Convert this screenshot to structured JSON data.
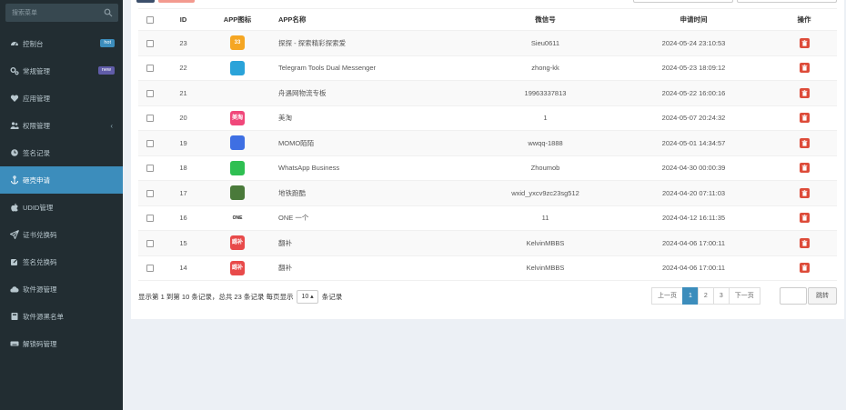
{
  "sidebar": {
    "search_placeholder": "搜索菜单",
    "items": [
      {
        "label": "控制台",
        "icon": "dashboard-icon",
        "badge": "hot",
        "badge_color": "#3c8dbc"
      },
      {
        "label": "常规管理",
        "icon": "cogs-icon",
        "badge": "new",
        "badge_color": "#605ca8"
      },
      {
        "label": "应用管理",
        "icon": "heart-icon"
      },
      {
        "label": "权限管理",
        "icon": "users-icon",
        "chevron": "‹"
      },
      {
        "label": "签名记录",
        "icon": "clock-icon"
      },
      {
        "label": "砸壳申请",
        "icon": "anchor-icon",
        "active": true
      },
      {
        "label": "UDID管理",
        "icon": "apple-icon"
      },
      {
        "label": "证书兑换码",
        "icon": "send-icon"
      },
      {
        "label": "签名兑换码",
        "icon": "edit-icon"
      },
      {
        "label": "软件源管理",
        "icon": "cloud-icon"
      },
      {
        "label": "软件源黑名单",
        "icon": "book-icon"
      },
      {
        "label": "解锁码管理",
        "icon": "keyboard-icon"
      }
    ]
  },
  "table": {
    "headers": [
      "ID",
      "APP图标",
      "APP名称",
      "微信号",
      "申请时间",
      "操作"
    ],
    "rows": [
      {
        "id": "23",
        "icon": "orange-app-icon",
        "icon_color": "#f5a623",
        "icon_text": "33",
        "name": "探探 - 探索精彩探索爱",
        "wechat": "Sieu0611",
        "time": "2024-05-24 23:10:53"
      },
      {
        "id": "22",
        "icon": "telegram-icon",
        "icon_color": "#2aa3d9",
        "icon_text": "",
        "name": "Telegram Tools Dual Messenger",
        "wechat": "zhong-kk",
        "time": "2024-05-23 18:09:12"
      },
      {
        "id": "21",
        "icon": "",
        "icon_color": "",
        "icon_text": "",
        "name": "舟遇网物流专板",
        "wechat": "19963337813",
        "time": "2024-05-22 16:00:16"
      },
      {
        "id": "20",
        "icon": "meitao-icon",
        "icon_color": "#f0477a",
        "icon_text": "美淘",
        "name": "美淘",
        "wechat": "1",
        "time": "2024-05-07 20:24:32"
      },
      {
        "id": "19",
        "icon": "momo-icon",
        "icon_color": "#3e6fe3",
        "icon_text": "",
        "name": "MOMO陌陌",
        "wechat": "wwqq-1888",
        "time": "2024-05-01 14:34:57"
      },
      {
        "id": "18",
        "icon": "whatsapp-business-icon",
        "icon_color": "#2fbf52",
        "icon_text": "",
        "name": "WhatsApp Business",
        "wechat": "Zhoumob",
        "time": "2024-04-30 00:00:39"
      },
      {
        "id": "17",
        "icon": "subway-runner-icon",
        "icon_color": "#4a7a3a",
        "icon_text": "",
        "name": "地铁跑酷",
        "wechat": "wxid_yxcv9zc23sg512",
        "time": "2024-04-20 07:11:03"
      },
      {
        "id": "16",
        "icon": "one-icon",
        "icon_color": "#ffffff",
        "icon_text": "ONE",
        "name": "ONE 一个",
        "wechat": "11",
        "time": "2024-04-12 16:11:35"
      },
      {
        "id": "15",
        "icon": "douban-icon",
        "icon_color": "#e84a4a",
        "icon_text": "踢补",
        "name": "翻补",
        "wechat": "KelvinMBBS",
        "time": "2024-04-06 17:00:11"
      },
      {
        "id": "14",
        "icon": "douban-icon",
        "icon_color": "#e84a4a",
        "icon_text": "踢补",
        "name": "翻补",
        "wechat": "KelvinMBBS",
        "time": "2024-04-06 17:00:11"
      }
    ]
  },
  "footer": {
    "info_pre": "显示第 1 到第 10 条记录，总共 23 条记录 每页显示",
    "page_size": "10 ▴",
    "info_post": "条记录"
  },
  "pager": {
    "prev": "上一页",
    "pages": [
      "1",
      "2",
      "3"
    ],
    "current": "1",
    "next": "下一页",
    "jump": "跳转"
  },
  "colors": {
    "sidebar_bg": "#222d32",
    "accent": "#3c8dbc",
    "danger": "#dd4b39"
  }
}
